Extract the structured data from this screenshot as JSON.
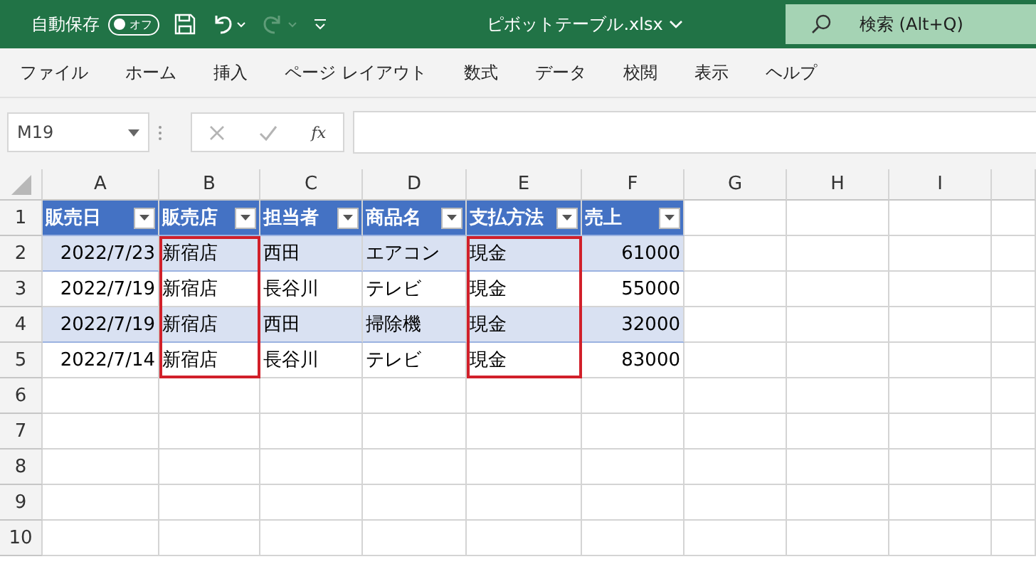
{
  "title_bar": {
    "autosave_label": "自動保存",
    "autosave_toggle": {
      "label": "オフ",
      "on": false
    },
    "file_name": "ピボットテーブル.xlsx",
    "search_placeholder": "検索 (Alt+Q)"
  },
  "ribbon_tabs": [
    "ファイル",
    "ホーム",
    "挿入",
    "ページ レイアウト",
    "数式",
    "データ",
    "校閲",
    "表示",
    "ヘルプ"
  ],
  "formula_bar": {
    "name_box": "M19",
    "function_label": "fx"
  },
  "sheet": {
    "column_letters": [
      "A",
      "B",
      "C",
      "D",
      "E",
      "F",
      "G",
      "H",
      "I"
    ],
    "row_numbers": [
      "1",
      "2",
      "3",
      "4",
      "5",
      "6",
      "7",
      "8",
      "9",
      "10"
    ],
    "table": {
      "columns": [
        {
          "header": "販売日",
          "kind": "date",
          "outlined": false
        },
        {
          "header": "販売店",
          "kind": "text",
          "outlined": true
        },
        {
          "header": "担当者",
          "kind": "text",
          "outlined": false
        },
        {
          "header": "商品名",
          "kind": "text",
          "outlined": false
        },
        {
          "header": "支払方法",
          "kind": "text",
          "outlined": true
        },
        {
          "header": "売上",
          "kind": "number",
          "outlined": false
        }
      ],
      "rows": [
        [
          "2022/7/23",
          "新宿店",
          "西田",
          "エアコン",
          "現金",
          "61000"
        ],
        [
          "2022/7/19",
          "新宿店",
          "長谷川",
          "テレビ",
          "現金",
          "55000"
        ],
        [
          "2022/7/19",
          "新宿店",
          "西田",
          "掃除機",
          "現金",
          "32000"
        ],
        [
          "2022/7/14",
          "新宿店",
          "長谷川",
          "テレビ",
          "現金",
          "83000"
        ]
      ]
    }
  }
}
